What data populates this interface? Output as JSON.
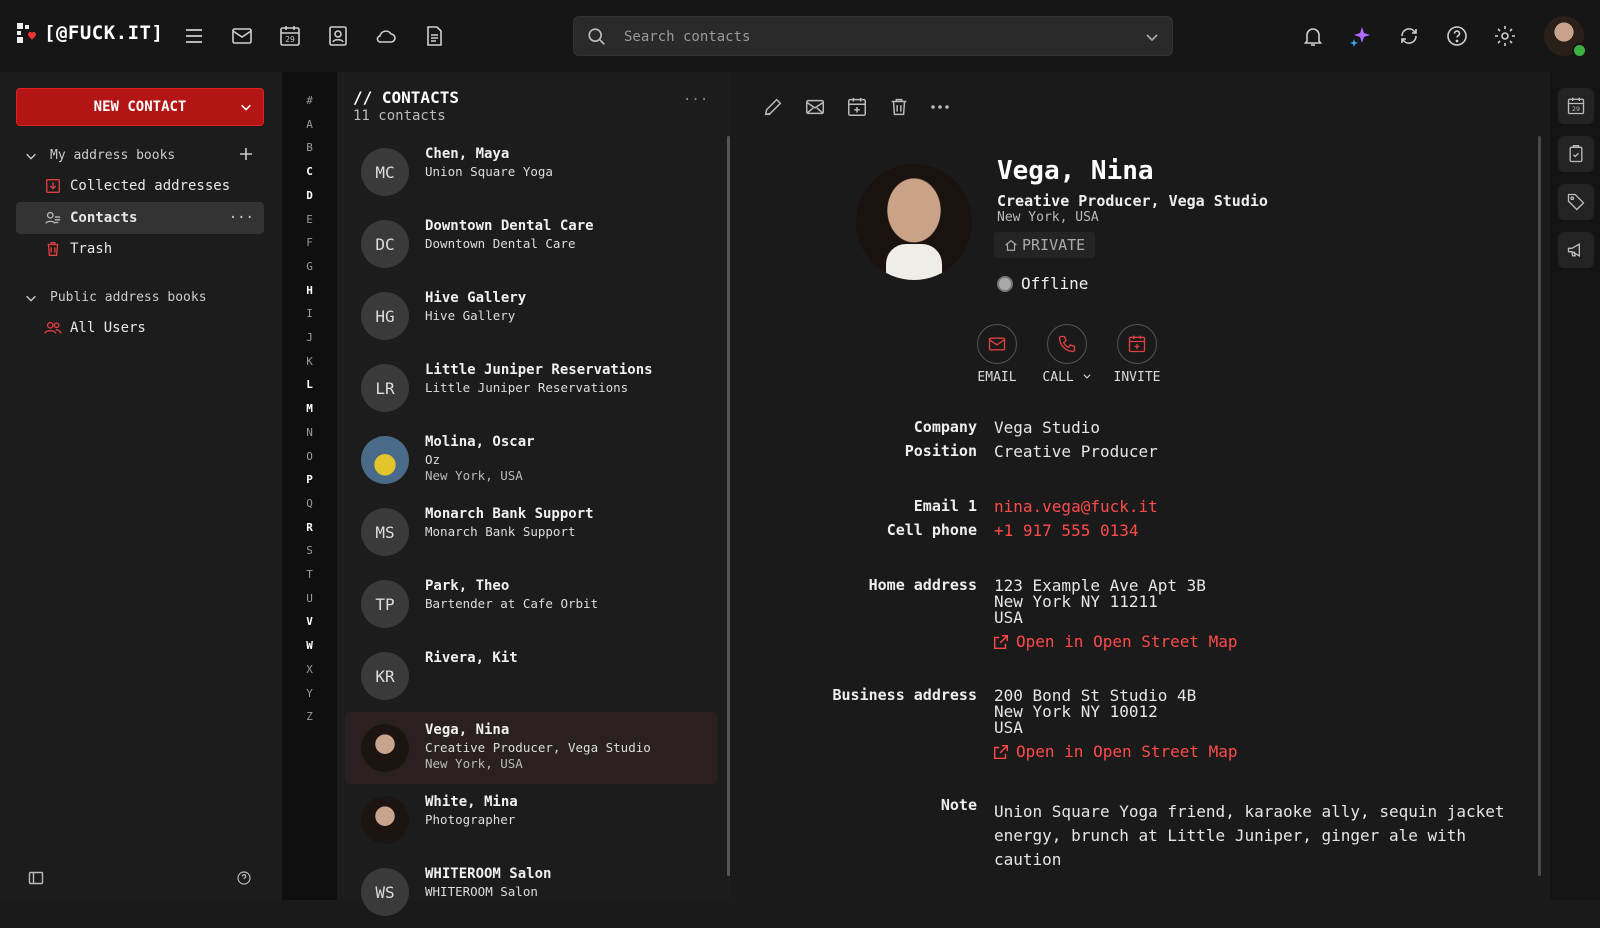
{
  "app": {
    "logo_text": "[@FUCK.IT]"
  },
  "topnav": {
    "icons": [
      "menu-icon",
      "mail-icon",
      "calendar-icon",
      "contacts-icon",
      "cloud-icon",
      "document-icon"
    ],
    "calendar_day": "29",
    "right_icons": [
      "bell-icon",
      "sparkle-icon",
      "sync-icon",
      "help-icon",
      "gear-icon"
    ]
  },
  "search": {
    "placeholder": "Search contacts"
  },
  "sidebar": {
    "new_contact": "NEW CONTACT",
    "my_books_label": "My address books",
    "my_books": [
      {
        "label": "Collected addresses",
        "icon": "download-icon"
      },
      {
        "label": "Contacts",
        "icon": "people-icon",
        "active": true
      },
      {
        "label": "Trash",
        "icon": "trash-icon"
      }
    ],
    "public_books_label": "Public address books",
    "public_books": [
      {
        "label": "All Users",
        "icon": "users-icon"
      }
    ]
  },
  "alphabet": [
    "#",
    "A",
    "B",
    "C",
    "D",
    "E",
    "F",
    "G",
    "H",
    "I",
    "J",
    "K",
    "L",
    "M",
    "N",
    "O",
    "P",
    "Q",
    "R",
    "S",
    "T",
    "U",
    "V",
    "W",
    "X",
    "Y",
    "Z"
  ],
  "alphabet_bold": [
    "C",
    "D",
    "H",
    "L",
    "M",
    "P",
    "R",
    "V",
    "W"
  ],
  "list": {
    "title": "// CONTACTS",
    "count": "11 contacts",
    "more": "···",
    "contacts": [
      {
        "initials": "MC",
        "name": "Chen, Maya",
        "line2": "Union Square Yoga",
        "line3": ""
      },
      {
        "initials": "DC",
        "name": "Downtown Dental Care",
        "line2": "Downtown Dental Care",
        "line3": ""
      },
      {
        "initials": "HG",
        "name": "Hive Gallery",
        "line2": "Hive Gallery",
        "line3": ""
      },
      {
        "initials": "LR",
        "name": "Little Juniper Reservations",
        "line2": "Little Juniper Reservations",
        "line3": ""
      },
      {
        "initials": "",
        "name": "Molina, Oscar",
        "line2": "Oz",
        "line3": "New York, USA",
        "photo": "photo1"
      },
      {
        "initials": "MS",
        "name": "Monarch Bank Support",
        "line2": "Monarch Bank Support",
        "line3": ""
      },
      {
        "initials": "TP",
        "name": "Park, Theo",
        "line2": "Bartender at Cafe Orbit",
        "line3": ""
      },
      {
        "initials": "KR",
        "name": "Rivera, Kit",
        "line2": "",
        "line3": ""
      },
      {
        "initials": "",
        "name": "Vega, Nina",
        "line2": "Creative Producer, Vega Studio",
        "line3": "New York, USA",
        "photo": "photo2",
        "selected": true
      },
      {
        "initials": "",
        "name": "White, Mina",
        "line2": "Photographer",
        "line3": "",
        "photo": "photo2"
      },
      {
        "initials": "WS",
        "name": "WHITEROOM Salon",
        "line2": "WHITEROOM Salon",
        "line3": ""
      }
    ]
  },
  "detail": {
    "toolbar": [
      "edit-icon",
      "mail-icon",
      "calendar-add-icon",
      "trash-icon",
      "more-icon"
    ],
    "name": "Vega, Nina",
    "subtitle": "Creative Producer, Vega Studio",
    "location": "New York, USA",
    "badge": "PRIVATE",
    "status": "Offline",
    "actions": [
      {
        "label": "EMAIL",
        "icon": "mail-icon"
      },
      {
        "label": "CALL",
        "icon": "phone-icon"
      },
      {
        "label": "INVITE",
        "icon": "calendar-add-icon"
      }
    ],
    "fields": {
      "company_label": "Company",
      "company": "Vega Studio",
      "position_label": "Position",
      "position": "Creative Producer",
      "email_label": "Email 1",
      "email": "nina.vega@fuck.it",
      "phone_label": "Cell phone",
      "phone": "+1 917 555 0134",
      "home_label": "Home address",
      "home_line1": "123 Example Ave Apt 3B",
      "home_line2": "New York NY 11211",
      "home_line3": "USA",
      "business_label": "Business address",
      "biz_line1": "200 Bond St Studio 4B",
      "biz_line2": "New York NY 10012",
      "biz_line3": "USA",
      "osm_link": "Open in Open Street Map",
      "note_label": "Note",
      "note": "Union Square Yoga friend, karaoke ally, sequin jacket energy, brunch at Little Juniper, ginger ale with caution"
    }
  },
  "colors": {
    "accent": "#b31414",
    "link": "#ff4a4a"
  }
}
